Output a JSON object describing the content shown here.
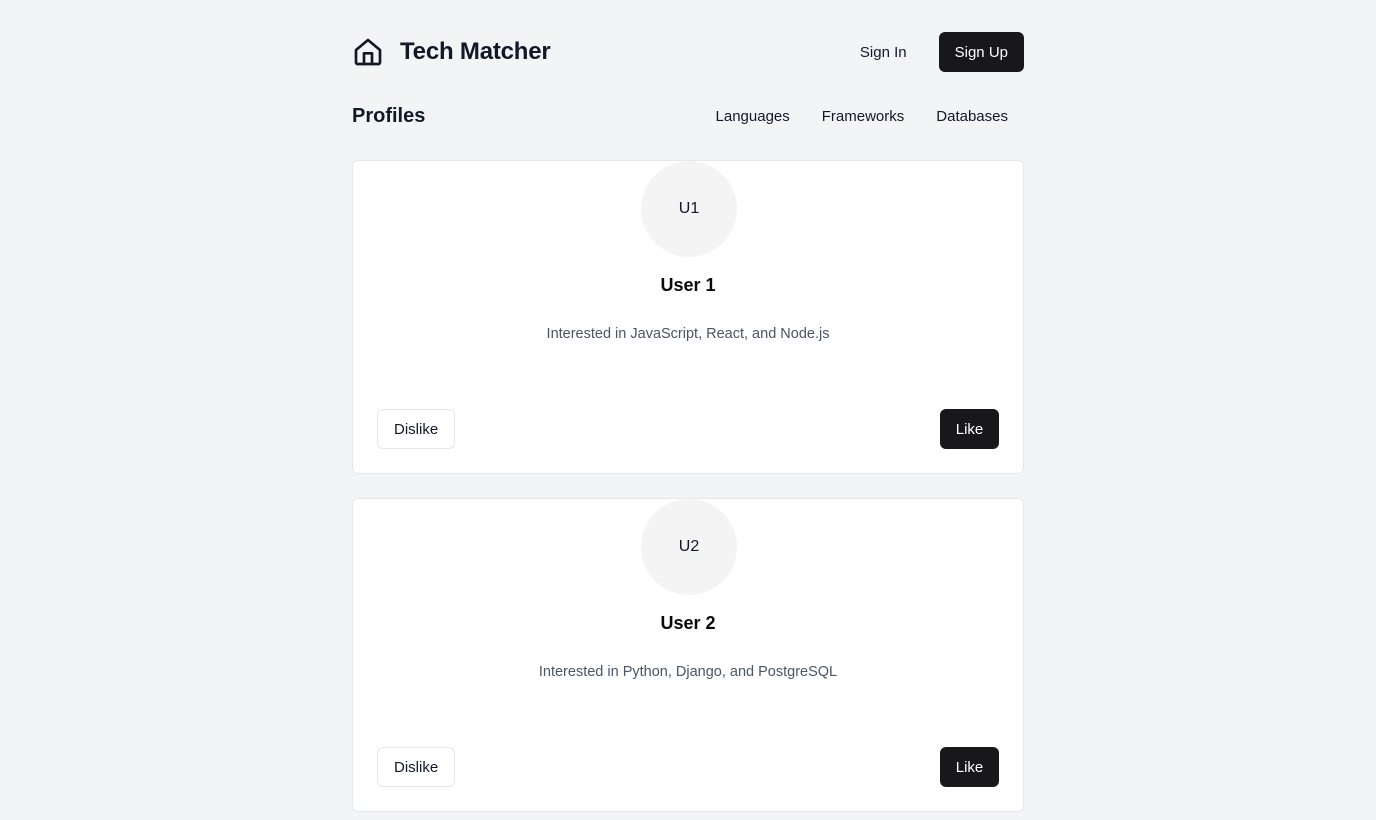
{
  "header": {
    "app_title": "Tech Matcher",
    "logo_icon": "home-icon",
    "sign_in_label": "Sign In",
    "sign_up_label": "Sign Up"
  },
  "section": {
    "title": "Profiles",
    "tabs": [
      {
        "label": "Languages"
      },
      {
        "label": "Frameworks"
      },
      {
        "label": "Databases"
      }
    ]
  },
  "profiles": [
    {
      "avatar_initials": "U1",
      "name": "User 1",
      "bio": "Interested in JavaScript, React, and Node.js",
      "dislike_label": "Dislike",
      "like_label": "Like"
    },
    {
      "avatar_initials": "U2",
      "name": "User 2",
      "bio": "Interested in Python, Django, and PostgreSQL",
      "dislike_label": "Dislike",
      "like_label": "Like"
    }
  ],
  "colors": {
    "background": "#f3f4f6",
    "primary_button": "#18181b",
    "card": "#ffffff",
    "avatar_bg": "#f4f4f5",
    "muted_text": "#4b5563"
  }
}
